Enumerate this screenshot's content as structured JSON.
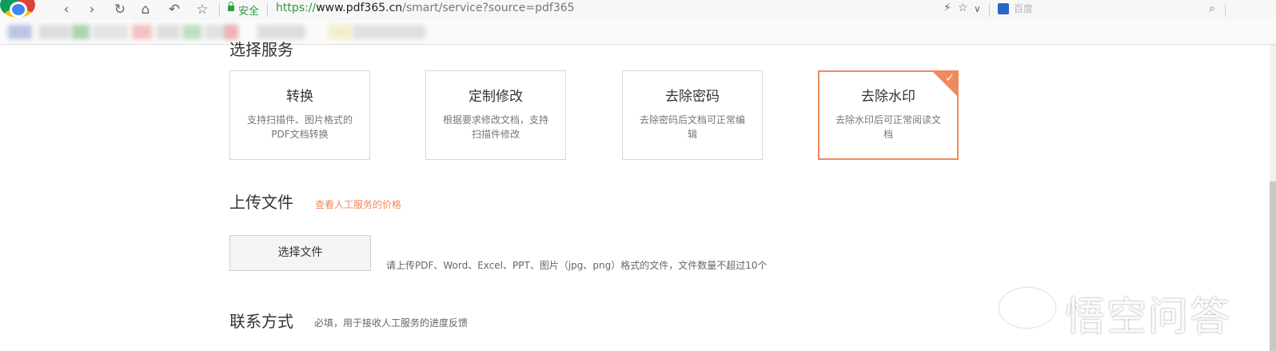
{
  "browser": {
    "secure_label": "安全",
    "url_scheme": "https://",
    "url_host": "www.pdf365.cn",
    "url_path": "/smart/service?source=pdf365",
    "search_placeholder": "百度",
    "baidu_glyph": "🐾",
    "icons": [
      "back-icon",
      "forward-icon",
      "reload-icon",
      "home-icon",
      "undo-icon",
      "star-icon",
      "lightning-icon",
      "star-icon",
      "chevron-down-icon",
      "search-icon"
    ]
  },
  "section_select": {
    "title": "选择服务",
    "cards": [
      {
        "title": "转换",
        "desc": "支持扫描件、图片格式的PDF文档转换",
        "selected": false
      },
      {
        "title": "定制修改",
        "desc": "根据要求修改文档，支持扫描件修改",
        "selected": false
      },
      {
        "title": "去除密码",
        "desc": "去除密码后文档可正常编辑",
        "selected": false
      },
      {
        "title": "去除水印",
        "desc": "去除水印后可正常阅读文档",
        "selected": true
      }
    ],
    "accent_color": "#f08a5d"
  },
  "section_upload": {
    "title": "上传文件",
    "price_link": "查看人工服务的价格",
    "button_label": "选择文件",
    "hint": "请上传PDF、Word、Excel、PPT、图片（jpg、png）格式的文件，文件数量不超过10个"
  },
  "section_contact": {
    "title": "联系方式",
    "note": "必填，用于接收人工服务的进度反馈"
  },
  "watermark": {
    "text": "悟空问答"
  }
}
